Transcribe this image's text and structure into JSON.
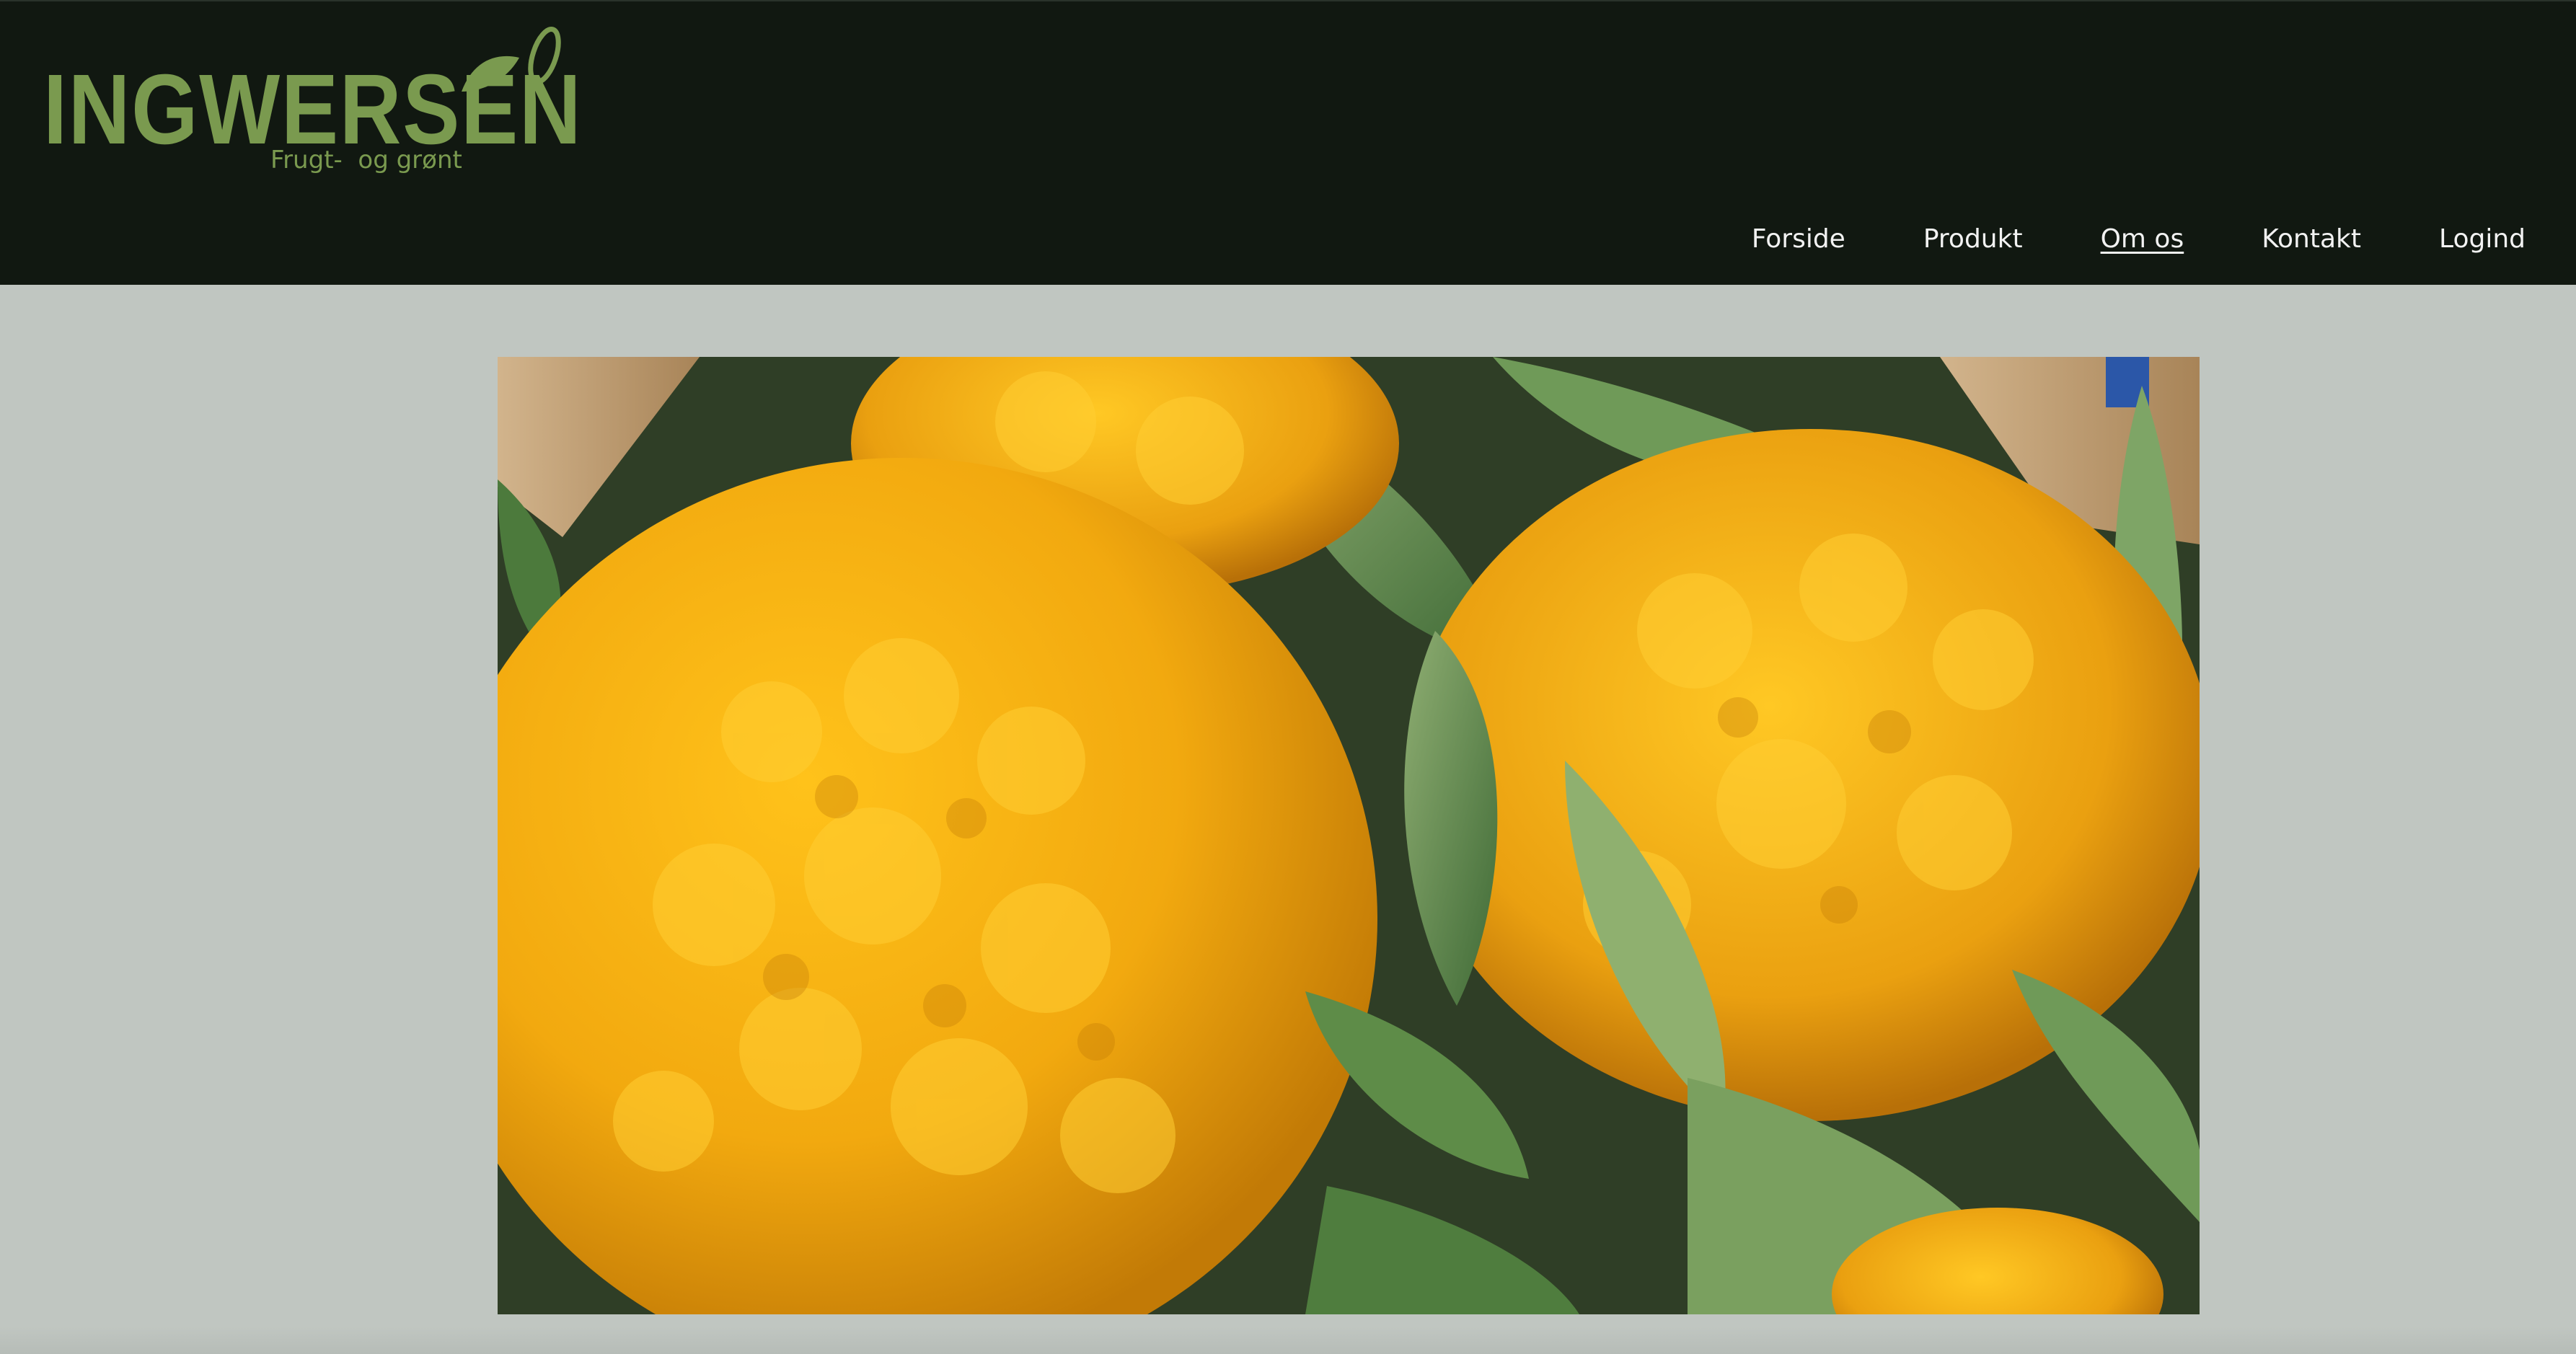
{
  "brand": {
    "name": "INGWERSEN",
    "tagline": "Frugt-  og grønt",
    "color": "#7a9a4f"
  },
  "nav": {
    "items": [
      {
        "label": "Forside",
        "active": false
      },
      {
        "label": "Produkt",
        "active": false
      },
      {
        "label": "Om os",
        "active": true
      },
      {
        "label": "Kontakt",
        "active": false
      },
      {
        "label": "Logind",
        "active": false
      }
    ]
  },
  "colors": {
    "header_bg": "#111811",
    "page_bg": "#c0c6c1",
    "nav_text": "#f2f2f2"
  },
  "hero": {
    "icon": "orange-cauliflower-photo"
  }
}
